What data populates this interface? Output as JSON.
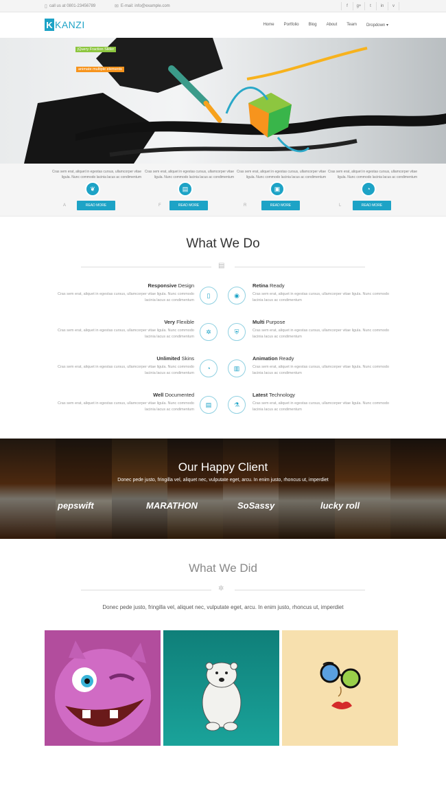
{
  "topbar": {
    "phone_text": "call us at 0801-23456789",
    "email_text": "E-mail: info@example.com",
    "social": [
      "f",
      "g+",
      "t",
      "in",
      "v"
    ]
  },
  "header": {
    "logo_mark": "K",
    "logo_text": "KANZI",
    "menu": [
      "Home",
      "Portfolio",
      "Blog",
      "About",
      "Team",
      "Dropdown ▾"
    ]
  },
  "hero": {
    "tag1": "jQuery Fraction Slider",
    "tag2": "animate multiple elements",
    "colors": {
      "green": "#8dc63f",
      "orange": "#f7941d"
    }
  },
  "features": [
    {
      "text": "Cras sem erat, aliquet in egestas cursus, ullamcorper vitae ligula. Nunc commodo lacinia lacus ac condimentum",
      "button": "READ MORE",
      "label": "A",
      "icon": "leaf-icon"
    },
    {
      "text": "Cras sem erat, aliquet in egestas cursus, ullamcorper vitae ligula. Nunc commodo lacinia lacus ac condimentum",
      "button": "READ MORE",
      "label": "F",
      "icon": "briefcase-icon"
    },
    {
      "text": "Cras sem erat, aliquet in egestas cursus, ullamcorper vitae ligula. Nunc commodo lacinia lacus ac condimentum",
      "button": "READ MORE",
      "label": "R",
      "icon": "image-icon"
    },
    {
      "text": "Cras sem erat, aliquet in egestas cursus, ullamcorper vitae ligula. Nunc commodo lacinia lacus ac condimentum",
      "button": "READ MORE",
      "label": "L",
      "icon": "gauge-icon"
    }
  ],
  "what_we_do": {
    "title": "What We Do",
    "services": [
      {
        "bold": "Responsive",
        "rest": " Design",
        "desc": "Cras sem erat, aliquet in egestas cursus, ullamcorper vitae ligula. Nunc commodo lacinia lacus ac condimentum",
        "icon": "tablet-icon"
      },
      {
        "bold": "Retina",
        "rest": " Ready",
        "desc": "Cras sem erat, aliquet in egestas cursus, ullamcorper vitae ligula. Nunc commodo lacinia lacus ac condimentum",
        "icon": "eye-icon"
      },
      {
        "bold": "Very",
        "rest": " Flexible",
        "desc": "Cras sem erat, aliquet in egestas cursus, ullamcorper vitae ligula. Nunc commodo lacinia lacus ac condimentum",
        "icon": "gear-icon"
      },
      {
        "bold": "Multi",
        "rest": " Purpose",
        "desc": "Cras sem erat, aliquet in egestas cursus, ullamcorper vitae ligula. Nunc commodo lacinia lacus ac condimentum",
        "icon": "shield-icon"
      },
      {
        "bold": "Unlimited",
        "rest": " Skins",
        "desc": "Cras sem erat, aliquet in egestas cursus, ullamcorper vitae ligula. Nunc commodo lacinia lacus ac condimentum",
        "icon": "dashboard-icon"
      },
      {
        "bold": "Animation",
        "rest": " Ready",
        "desc": "Cras sem erat, aliquet in egestas cursus, ullamcorper vitae ligula. Nunc commodo lacinia lacus ac condimentum",
        "icon": "film-icon"
      },
      {
        "bold": "Well",
        "rest": " Documented",
        "desc": "Cras sem erat, aliquet in egestas cursus, ullamcorper vitae ligula. Nunc commodo lacinia lacus ac condimentum",
        "icon": "document-icon"
      },
      {
        "bold": "Latest",
        "rest": " Technology",
        "desc": "Cras sem erat, aliquet in egestas cursus, ullamcorper vitae ligula. Nunc commodo lacinia lacus ac condimentum",
        "icon": "flask-icon"
      }
    ]
  },
  "clients": {
    "title": "Our Happy Client",
    "subtitle": "Donec pede justo, fringilla vel, aliquet nec, vulputate eget, arcu. In enim justo, rhoncus ut, imperdiet",
    "brands": [
      "pepswift",
      "MARATHON",
      "SoSassy",
      "lucky roll"
    ]
  },
  "what_we_did": {
    "title": "What We Did",
    "subtitle": "Donec pede justo, fringilla vel, aliquet nec, vulputate eget, arcu. In enim justo, rhoncus ut, imperdiet",
    "tile_colors": [
      "#b24d9d",
      "#17968e",
      "#f7e0ae"
    ]
  },
  "accent": "#1da3c6"
}
